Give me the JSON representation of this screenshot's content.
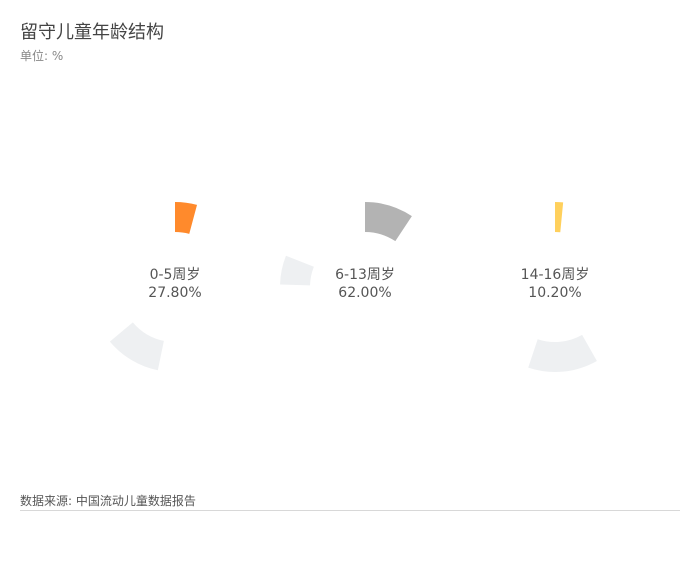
{
  "title": "留守儿童年龄结构",
  "unit_label": "单位: %",
  "source": "数据来源: 中国流动儿童数据报告",
  "chart_data": {
    "type": "pie",
    "title": "留守儿童年龄结构",
    "unit": "%",
    "categories": [
      "0-5周岁",
      "6-13周岁",
      "14-16周岁"
    ],
    "values": [
      27.8,
      62.0,
      10.2
    ],
    "value_labels": [
      "27.80%",
      "62.00%",
      "10.20%"
    ],
    "colors": [
      "#ff8a2c",
      "#b3b3b3",
      "#ffd05c"
    ],
    "remainder_color": "#eef0f2"
  }
}
